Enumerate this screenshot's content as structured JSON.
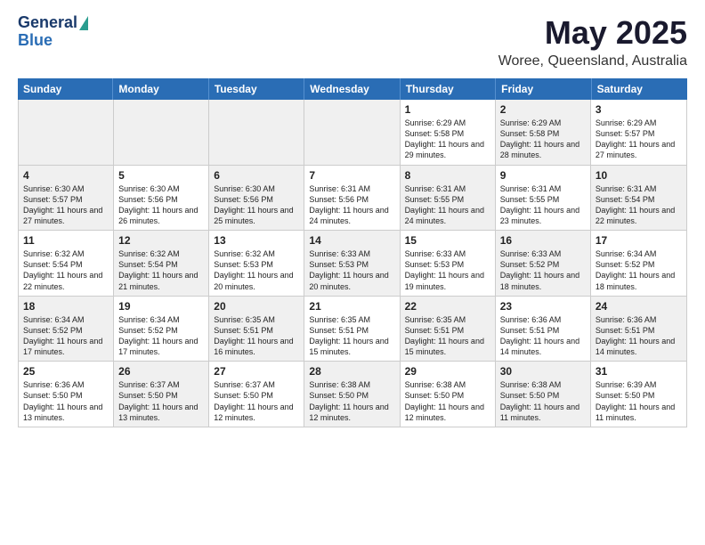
{
  "header": {
    "logo_line1": "General",
    "logo_line2": "Blue",
    "title": "May 2025",
    "subtitle": "Woree, Queensland, Australia"
  },
  "calendar": {
    "days_of_week": [
      "Sunday",
      "Monday",
      "Tuesday",
      "Wednesday",
      "Thursday",
      "Friday",
      "Saturday"
    ],
    "rows": [
      [
        {
          "day": "",
          "text": "",
          "shaded": true
        },
        {
          "day": "",
          "text": "",
          "shaded": true
        },
        {
          "day": "",
          "text": "",
          "shaded": true
        },
        {
          "day": "",
          "text": "",
          "shaded": true
        },
        {
          "day": "1",
          "text": "Sunrise: 6:29 AM\nSunset: 5:58 PM\nDaylight: 11 hours\nand 29 minutes."
        },
        {
          "day": "2",
          "text": "Sunrise: 6:29 AM\nSunset: 5:58 PM\nDaylight: 11 hours\nand 28 minutes.",
          "shaded": true
        },
        {
          "day": "3",
          "text": "Sunrise: 6:29 AM\nSunset: 5:57 PM\nDaylight: 11 hours\nand 27 minutes."
        }
      ],
      [
        {
          "day": "4",
          "text": "Sunrise: 6:30 AM\nSunset: 5:57 PM\nDaylight: 11 hours\nand 27 minutes.",
          "shaded": true
        },
        {
          "day": "5",
          "text": "Sunrise: 6:30 AM\nSunset: 5:56 PM\nDaylight: 11 hours\nand 26 minutes."
        },
        {
          "day": "6",
          "text": "Sunrise: 6:30 AM\nSunset: 5:56 PM\nDaylight: 11 hours\nand 25 minutes.",
          "shaded": true
        },
        {
          "day": "7",
          "text": "Sunrise: 6:31 AM\nSunset: 5:56 PM\nDaylight: 11 hours\nand 24 minutes."
        },
        {
          "day": "8",
          "text": "Sunrise: 6:31 AM\nSunset: 5:55 PM\nDaylight: 11 hours\nand 24 minutes.",
          "shaded": true
        },
        {
          "day": "9",
          "text": "Sunrise: 6:31 AM\nSunset: 5:55 PM\nDaylight: 11 hours\nand 23 minutes."
        },
        {
          "day": "10",
          "text": "Sunrise: 6:31 AM\nSunset: 5:54 PM\nDaylight: 11 hours\nand 22 minutes.",
          "shaded": true
        }
      ],
      [
        {
          "day": "11",
          "text": "Sunrise: 6:32 AM\nSunset: 5:54 PM\nDaylight: 11 hours\nand 22 minutes."
        },
        {
          "day": "12",
          "text": "Sunrise: 6:32 AM\nSunset: 5:54 PM\nDaylight: 11 hours\nand 21 minutes.",
          "shaded": true
        },
        {
          "day": "13",
          "text": "Sunrise: 6:32 AM\nSunset: 5:53 PM\nDaylight: 11 hours\nand 20 minutes."
        },
        {
          "day": "14",
          "text": "Sunrise: 6:33 AM\nSunset: 5:53 PM\nDaylight: 11 hours\nand 20 minutes.",
          "shaded": true
        },
        {
          "day": "15",
          "text": "Sunrise: 6:33 AM\nSunset: 5:53 PM\nDaylight: 11 hours\nand 19 minutes."
        },
        {
          "day": "16",
          "text": "Sunrise: 6:33 AM\nSunset: 5:52 PM\nDaylight: 11 hours\nand 18 minutes.",
          "shaded": true
        },
        {
          "day": "17",
          "text": "Sunrise: 6:34 AM\nSunset: 5:52 PM\nDaylight: 11 hours\nand 18 minutes."
        }
      ],
      [
        {
          "day": "18",
          "text": "Sunrise: 6:34 AM\nSunset: 5:52 PM\nDaylight: 11 hours\nand 17 minutes.",
          "shaded": true
        },
        {
          "day": "19",
          "text": "Sunrise: 6:34 AM\nSunset: 5:52 PM\nDaylight: 11 hours\nand 17 minutes."
        },
        {
          "day": "20",
          "text": "Sunrise: 6:35 AM\nSunset: 5:51 PM\nDaylight: 11 hours\nand 16 minutes.",
          "shaded": true
        },
        {
          "day": "21",
          "text": "Sunrise: 6:35 AM\nSunset: 5:51 PM\nDaylight: 11 hours\nand 15 minutes."
        },
        {
          "day": "22",
          "text": "Sunrise: 6:35 AM\nSunset: 5:51 PM\nDaylight: 11 hours\nand 15 minutes.",
          "shaded": true
        },
        {
          "day": "23",
          "text": "Sunrise: 6:36 AM\nSunset: 5:51 PM\nDaylight: 11 hours\nand 14 minutes."
        },
        {
          "day": "24",
          "text": "Sunrise: 6:36 AM\nSunset: 5:51 PM\nDaylight: 11 hours\nand 14 minutes.",
          "shaded": true
        }
      ],
      [
        {
          "day": "25",
          "text": "Sunrise: 6:36 AM\nSunset: 5:50 PM\nDaylight: 11 hours\nand 13 minutes."
        },
        {
          "day": "26",
          "text": "Sunrise: 6:37 AM\nSunset: 5:50 PM\nDaylight: 11 hours\nand 13 minutes.",
          "shaded": true
        },
        {
          "day": "27",
          "text": "Sunrise: 6:37 AM\nSunset: 5:50 PM\nDaylight: 11 hours\nand 12 minutes."
        },
        {
          "day": "28",
          "text": "Sunrise: 6:38 AM\nSunset: 5:50 PM\nDaylight: 11 hours\nand 12 minutes.",
          "shaded": true
        },
        {
          "day": "29",
          "text": "Sunrise: 6:38 AM\nSunset: 5:50 PM\nDaylight: 11 hours\nand 12 minutes."
        },
        {
          "day": "30",
          "text": "Sunrise: 6:38 AM\nSunset: 5:50 PM\nDaylight: 11 hours\nand 11 minutes.",
          "shaded": true
        },
        {
          "day": "31",
          "text": "Sunrise: 6:39 AM\nSunset: 5:50 PM\nDaylight: 11 hours\nand 11 minutes."
        }
      ]
    ]
  }
}
